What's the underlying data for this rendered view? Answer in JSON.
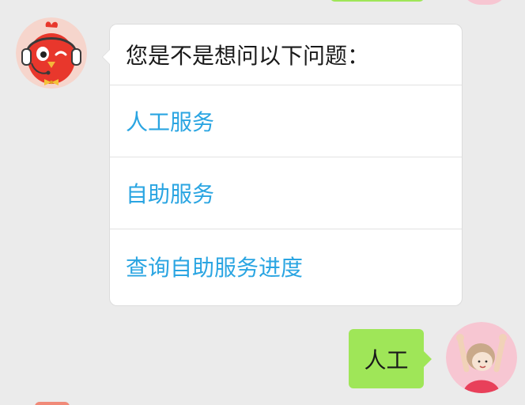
{
  "colors": {
    "background": "#ebebeb",
    "incoming_bubble": "#ffffff",
    "outgoing_bubble": "#9fe658",
    "option_link": "#2aa5e2",
    "divider": "#e2e2e2"
  },
  "conversation": {
    "bot_message": {
      "avatar_icon": "red-bird-headset-icon",
      "prompt": "您是不是想问以下问题：",
      "options": [
        "人工服务",
        "自助服务",
        "查询自助服务进度"
      ]
    },
    "user_message": {
      "avatar_icon": "girl-hands-up-icon",
      "text": "人工"
    }
  }
}
